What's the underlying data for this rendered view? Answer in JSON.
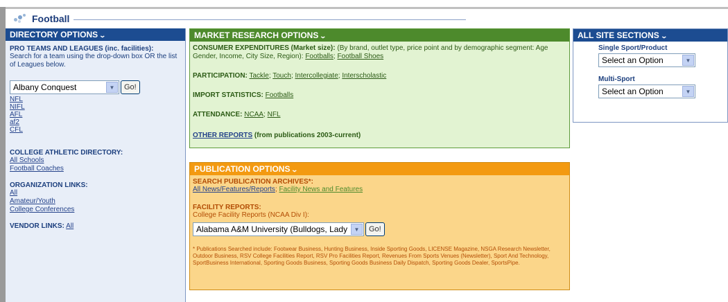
{
  "header": {
    "title": "Football"
  },
  "directory": {
    "title": "DIRECTORY OPTIONS",
    "pro_label": "PRO TEAMS AND LEAGUES (inc. facilities):",
    "pro_desc": "Search for a team using the drop-down box OR the list of Leagues below.",
    "team_select": "Albany Conquest",
    "go_label": "Go!",
    "leagues": [
      "NFL",
      "NIFL",
      "AFL",
      "af2",
      "CFL"
    ],
    "college_label": "COLLEGE ATHLETIC DIRECTORY:",
    "college_links": [
      "All Schools",
      "Football Coaches"
    ],
    "org_label": "ORGANIZATION LINKS:",
    "org_links": [
      "All",
      "Amateur/Youth",
      "College Conferences"
    ],
    "vendor_label": "VENDOR LINKS:",
    "vendor_link": "All"
  },
  "market": {
    "title": "MARKET RESEARCH OPTIONS",
    "consumer_label": "CONSUMER EXPENDITURES (Market size):",
    "consumer_text": "(By brand, outlet type, price point and by demographic segment: Age Gender, Income, City Size, Region):",
    "consumer_links": [
      "Footballs",
      "Football Shoes"
    ],
    "participation_label": "PARTICIPATION:",
    "participation_links": [
      "Tackle",
      "Touch",
      "Intercollegiate",
      "Interscholastic"
    ],
    "import_label": "IMPORT STATISTICS:",
    "import_link": "Footballs",
    "attendance_label": "ATTENDANCE:",
    "attendance_links": [
      "NCAA",
      "NFL"
    ],
    "other_link": "OTHER REPORTS",
    "other_text": "(from publications 2003-current)"
  },
  "publication": {
    "title": "PUBLICATION OPTIONS",
    "search_label": "SEARCH PUBLICATION ARCHIVES*:",
    "search_links": [
      "All News/Features/Reports",
      "Facility News and Features"
    ],
    "facility_label": "FACILITY REPORTS:",
    "facility_text": "College Facility Reports (NCAA Div I):",
    "facility_select": "Alabama A&M University (Bulldogs, Lady",
    "go_label": "Go!",
    "footnote": "* Publications Searched include: Footwear Business, Hunting Business, Inside Sporting Goods, LICENSE Magazine, NSGA Research Newsletter, Outdoor Business, RSV College Facilities Report, RSV Pro Facilities Report, Revenues From Sports Venues (Newsletter), Sport And Technology, SportBusiness International, Sporting Goods Business, Sporting Goods Business Daily Dispatch, Sporting Goods Dealer, SportsPipe."
  },
  "sections": {
    "title": "ALL SITE SECTIONS",
    "single_label": "Single Sport/Product",
    "single_select": "Select an Option",
    "multi_label": "Multi-Sport",
    "multi_select": "Select an Option"
  }
}
